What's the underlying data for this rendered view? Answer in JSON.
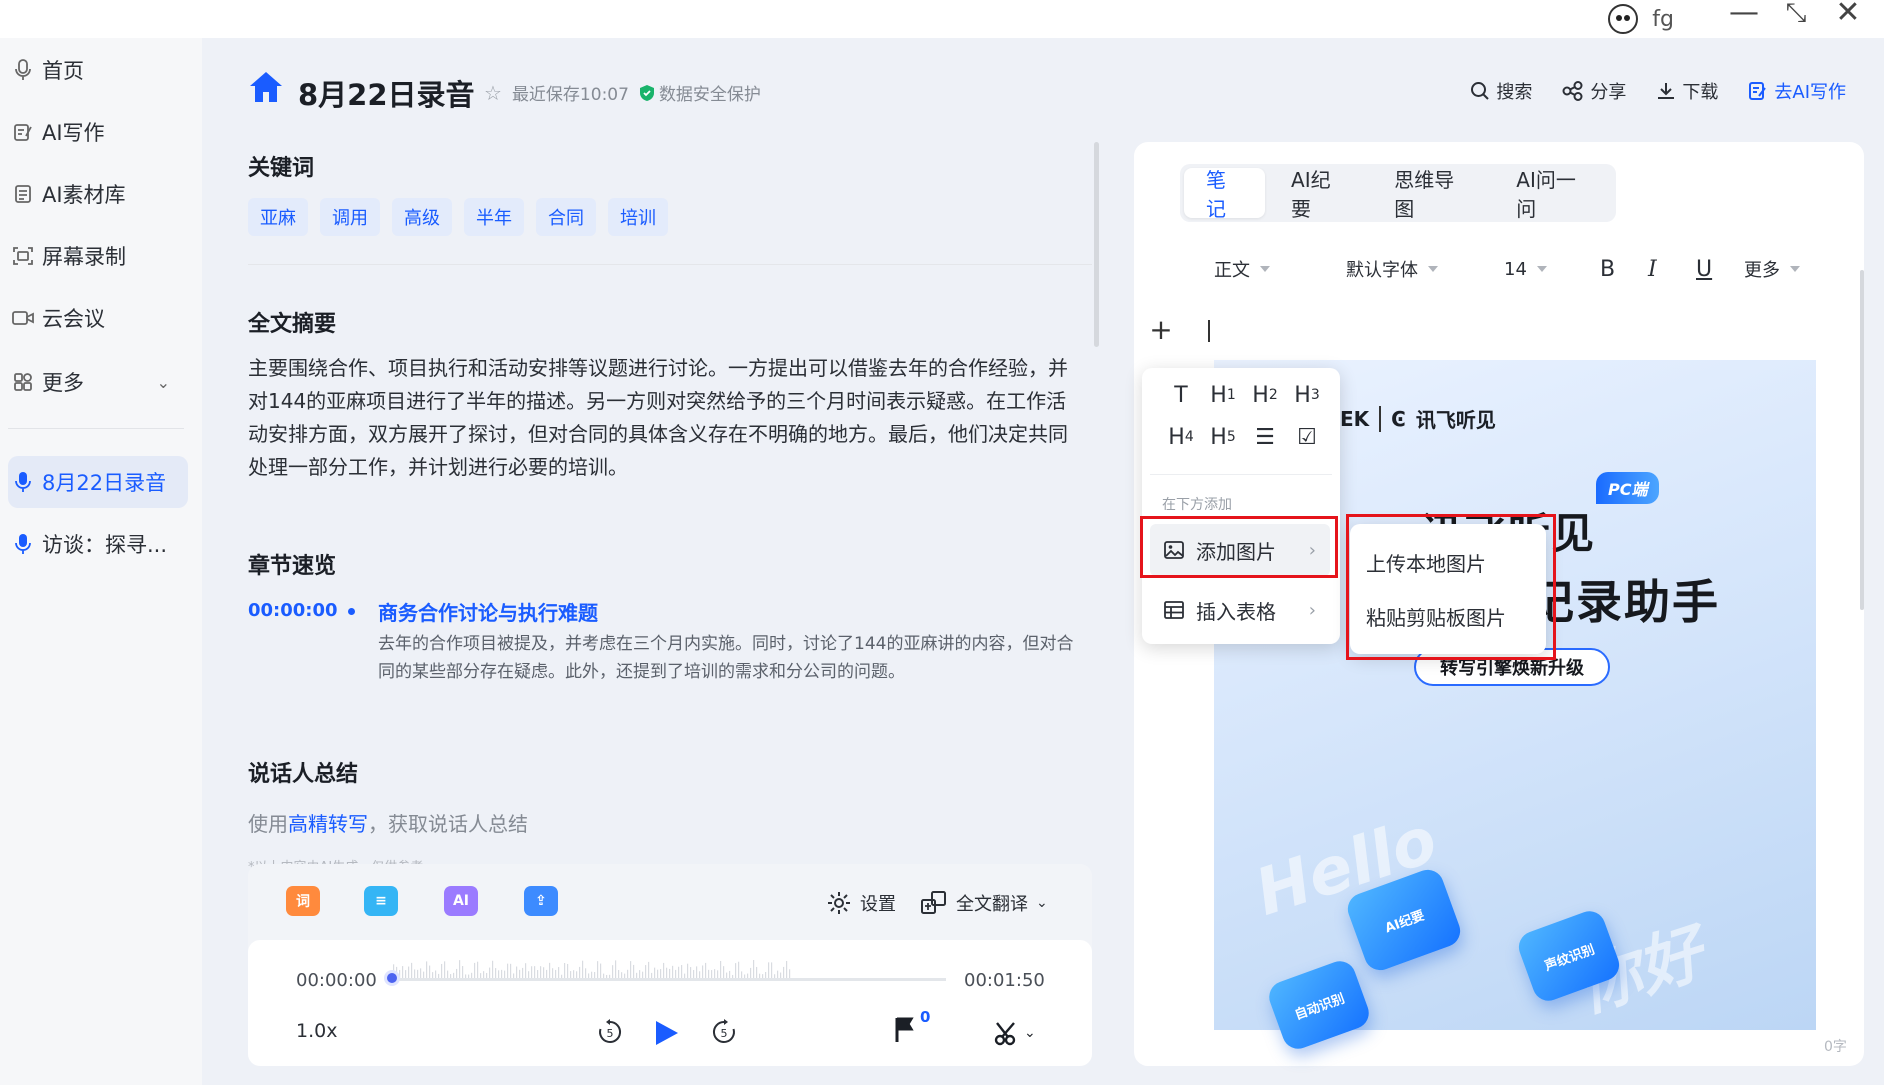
{
  "titlebar": {
    "username": "fg"
  },
  "sidebar": {
    "items": [
      {
        "label": "首页",
        "icon": "mic-icon"
      },
      {
        "label": "AI写作",
        "icon": "edit-icon"
      },
      {
        "label": "AI素材库",
        "icon": "doc-icon"
      },
      {
        "label": "屏幕录制",
        "icon": "screen-record-icon"
      },
      {
        "label": "云会议",
        "icon": "video-icon"
      },
      {
        "label": "更多",
        "icon": "grid-icon"
      }
    ],
    "recordings": [
      {
        "label": "8月22日录音",
        "active": true
      },
      {
        "label": "访谈：探寻...",
        "active": false
      }
    ]
  },
  "header": {
    "title": "8月22日录音",
    "saved": "最近保存10:07",
    "security": "数据安全保护",
    "actions": {
      "search": "搜索",
      "share": "分享",
      "download": "下载",
      "ai_write": "去AI写作"
    }
  },
  "keywords": {
    "title": "关键词",
    "items": [
      "亚麻",
      "调用",
      "高级",
      "半年",
      "合同",
      "培训"
    ]
  },
  "summary": {
    "title": "全文摘要",
    "text": "主要围绕合作、项目执行和活动安排等议题进行讨论。一方提出可以借鉴去年的合作经验，并对144的亚麻项目进行了半年的描述。另一方则对突然给予的三个月时间表示疑惑。在工作活动安排方面，双方展开了探讨，但对合同的具体含义存在不明确的地方。最后，他们决定共同处理一部分工作，并计划进行必要的培训。"
  },
  "chapters": {
    "title": "章节速览",
    "items": [
      {
        "time": "00:00:00",
        "title": "商务合作讨论与执行难题",
        "desc": "去年的合作项目被提及，并考虑在三个月内实施。同时，讨论了144的亚麻讲的内容，但对合同的某些部分存在疑虑。此外，还提到了培训的需求和分公司的问题。"
      }
    ]
  },
  "speaker": {
    "title": "说话人总结",
    "prefix": "使用",
    "link": "高精转写",
    "suffix": "，获取说话人总结",
    "disclaimer": "*以上内容由AI生成，仅供参考"
  },
  "player": {
    "tools": [
      {
        "label": "词",
        "color": "#ff8a3d"
      },
      {
        "label": "≡",
        "color": "#35b5f5"
      },
      {
        "label": "AI",
        "color": "#9b7bff"
      },
      {
        "label": "⇪",
        "color": "#3d8bff"
      }
    ],
    "settings": "设置",
    "translate": "全文翻译",
    "current_time": "00:00:00",
    "total_time": "00:01:50",
    "speed": "1.0x",
    "flag_count": "0",
    "progress": 0
  },
  "right_panel": {
    "tabs": [
      "笔记",
      "AI纪要",
      "思维导图",
      "AI问一问"
    ],
    "active_tab": "笔记",
    "format": {
      "style": "正文",
      "font": "默认字体",
      "size": "14",
      "more": "更多"
    },
    "word_count": "0字"
  },
  "popup": {
    "insert_below": "在下方添加",
    "add_image": "添加图片",
    "insert_table": "插入表格",
    "submenu": [
      "上传本地图片",
      "粘贴剪贴板图片"
    ]
  },
  "poster": {
    "brand": "讯飞听见",
    "badge": "PC端",
    "line1": "讯飞听见",
    "line2": "记录助手",
    "pill": "转写引擎焕新升级",
    "keys": [
      "AI纪要",
      "声纹识别",
      "自动识别",
      "Hello",
      "你好"
    ]
  },
  "colors": {
    "accent": "#1a5cff",
    "highlight_box": "#e5141b"
  }
}
